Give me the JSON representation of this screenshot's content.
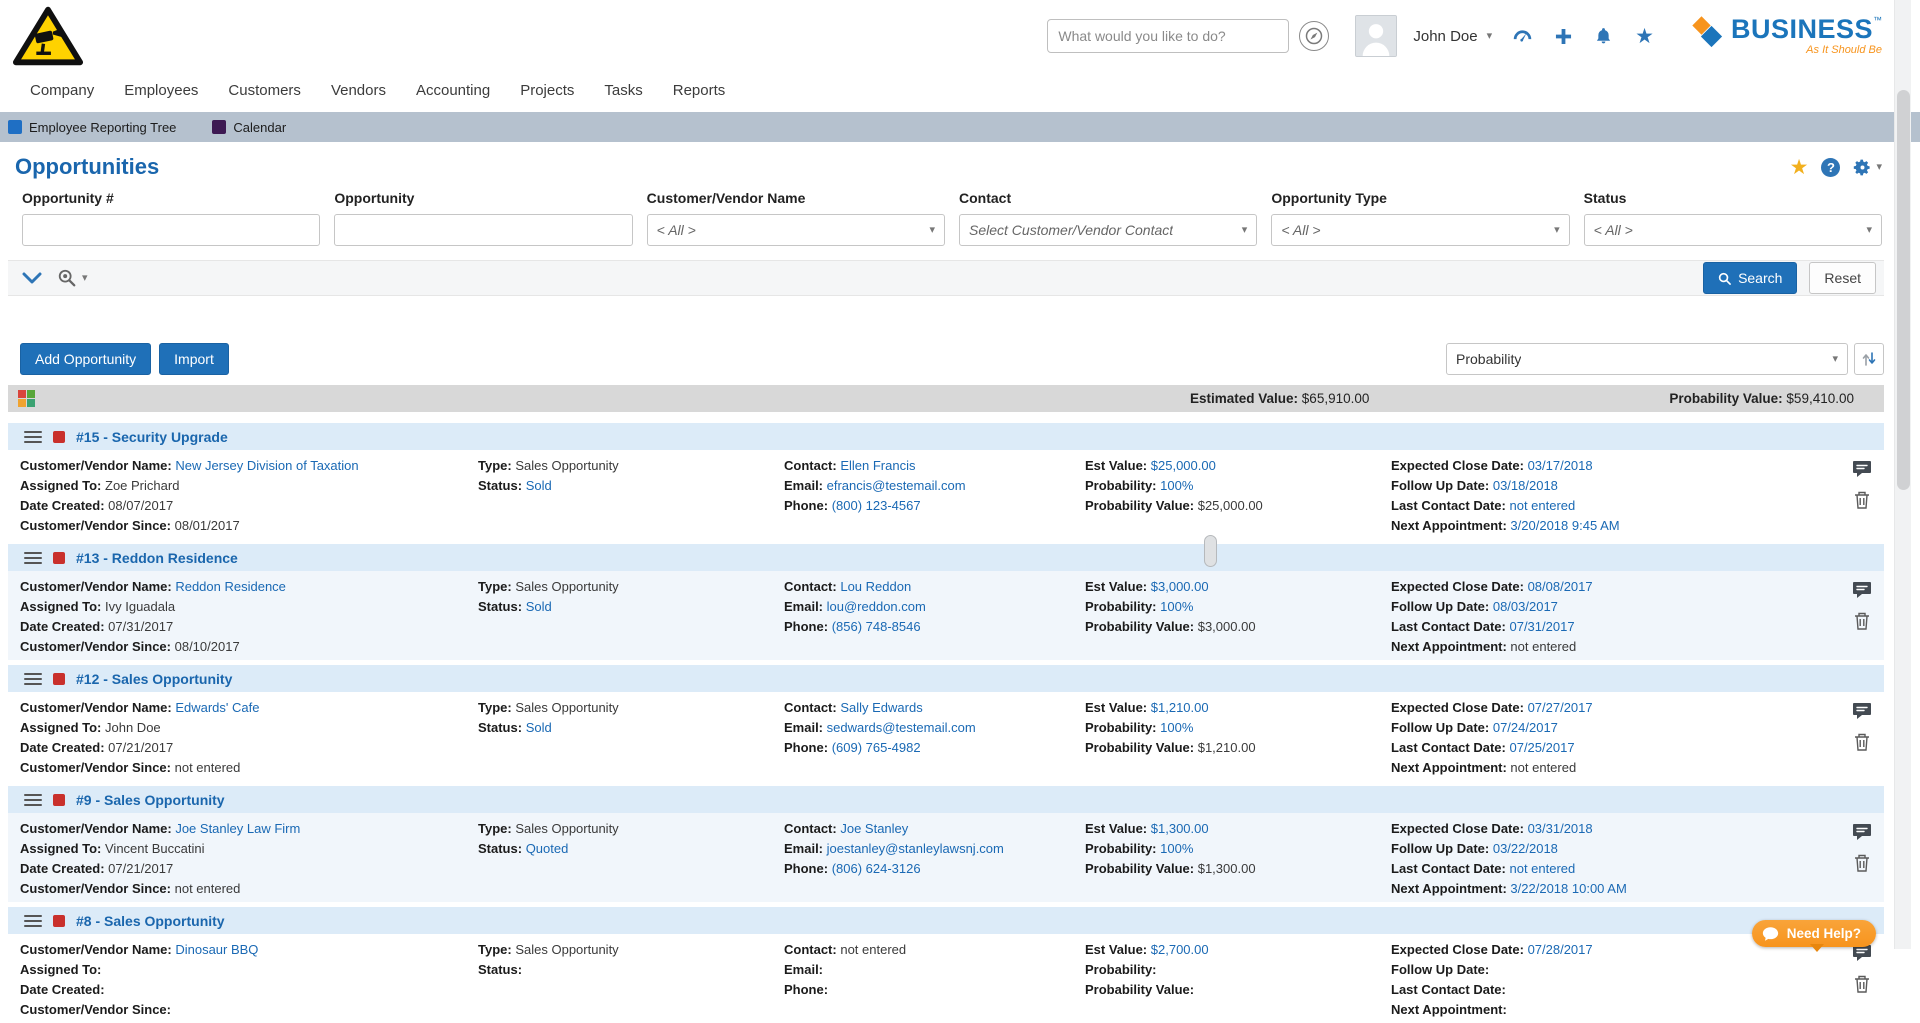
{
  "header": {
    "search_placeholder": "What would you like to do?",
    "user_name": "John Doe",
    "brand_name": "BUSINESS",
    "brand_tm": "™",
    "brand_tagline": "As It Should Be"
  },
  "nav": {
    "items": [
      "Company",
      "Employees",
      "Customers",
      "Vendors",
      "Accounting",
      "Projects",
      "Tasks",
      "Reports"
    ]
  },
  "quickbar": {
    "items": [
      {
        "label": "Employee Reporting Tree",
        "color": "#1f6fc4"
      },
      {
        "label": "Calendar",
        "color": "#3d1952"
      }
    ]
  },
  "page": {
    "title": "Opportunities"
  },
  "filters": {
    "fields": [
      {
        "label": "Opportunity #",
        "value": ""
      },
      {
        "label": "Opportunity",
        "value": ""
      },
      {
        "label": "Customer/Vendor Name",
        "value": "< All >"
      },
      {
        "label": "Contact",
        "value": "Select Customer/Vendor Contact"
      },
      {
        "label": "Opportunity Type",
        "value": "< All >"
      },
      {
        "label": "Status",
        "value": "< All >"
      }
    ],
    "search_label": "Search",
    "reset_label": "Reset"
  },
  "actions": {
    "add_label": "Add Opportunity",
    "import_label": "Import",
    "sort_value": "Probability"
  },
  "summary": {
    "estimated_label": "Estimated Value:",
    "estimated_value": "$65,910.00",
    "probability_label": "Probability Value:",
    "probability_value": "$59,410.00"
  },
  "row_labels": {
    "customer_vendor_name": "Customer/Vendor Name:",
    "assigned_to": "Assigned To:",
    "date_created": "Date Created:",
    "customer_vendor_since": "Customer/Vendor Since:",
    "type": "Type:",
    "status": "Status:",
    "contact": "Contact:",
    "email": "Email:",
    "phone": "Phone:",
    "est_value": "Est Value:",
    "probability": "Probability:",
    "probability_value": "Probability Value:",
    "expected_close_date": "Expected Close Date:",
    "follow_up_date": "Follow Up Date:",
    "last_contact_date": "Last Contact Date:",
    "next_appointment": "Next Appointment:"
  },
  "rows": [
    {
      "title": "#15 - Security Upgrade",
      "customer_vendor_name": "New Jersey Division of Taxation",
      "assigned_to": "Zoe Prichard",
      "date_created": "08/07/2017",
      "customer_vendor_since": "08/01/2017",
      "type": "Sales Opportunity",
      "status": "Sold",
      "contact": "Ellen Francis",
      "contact_cls": "link",
      "email": "efrancis@testemail.com",
      "phone": "(800) 123-4567",
      "est_value": "$25,000.00",
      "probability": "100%",
      "probability_value": "$25,000.00",
      "expected_close_date": "03/17/2018",
      "follow_up_date": "03/18/2018",
      "last_contact_date": "not entered",
      "next_appointment": "3/20/2018 9:45 AM",
      "next_appointment_cls": "link"
    },
    {
      "title": "#13 - Reddon Residence",
      "customer_vendor_name": "Reddon Residence",
      "assigned_to": "Ivy Iguadala",
      "date_created": "07/31/2017",
      "customer_vendor_since": "08/10/2017",
      "type": "Sales Opportunity",
      "status": "Sold",
      "contact": "Lou Reddon",
      "contact_cls": "link",
      "email": "lou@reddon.com",
      "phone": "(856) 748-8546",
      "est_value": "$3,000.00",
      "probability": "100%",
      "probability_value": "$3,000.00",
      "expected_close_date": "08/08/2017",
      "follow_up_date": "08/03/2017",
      "last_contact_date": "07/31/2017",
      "next_appointment": "not entered",
      "next_appointment_cls": "plain"
    },
    {
      "title": "#12 - Sales Opportunity",
      "customer_vendor_name": "Edwards' Cafe",
      "assigned_to": "John Doe",
      "date_created": "07/21/2017",
      "customer_vendor_since": "not entered",
      "type": "Sales Opportunity",
      "status": "Sold",
      "contact": "Sally Edwards",
      "contact_cls": "link",
      "email": "sedwards@testemail.com",
      "phone": "(609) 765-4982",
      "est_value": "$1,210.00",
      "probability": "100%",
      "probability_value": "$1,210.00",
      "expected_close_date": "07/27/2017",
      "follow_up_date": "07/24/2017",
      "last_contact_date": "07/25/2017",
      "next_appointment": "not entered",
      "next_appointment_cls": "plain"
    },
    {
      "title": "#9 - Sales Opportunity",
      "customer_vendor_name": "Joe Stanley Law Firm",
      "assigned_to": "Vincent Buccatini",
      "date_created": "07/21/2017",
      "customer_vendor_since": "not entered",
      "type": "Sales Opportunity",
      "status": "Quoted",
      "contact": "Joe Stanley",
      "contact_cls": "link",
      "email": "joestanley@stanleylawsnj.com",
      "phone": "(806) 624-3126",
      "est_value": "$1,300.00",
      "probability": "100%",
      "probability_value": "$1,300.00",
      "expected_close_date": "03/31/2018",
      "follow_up_date": "03/22/2018",
      "last_contact_date": "not entered",
      "next_appointment": "3/22/2018 10:00 AM",
      "next_appointment_cls": "link"
    },
    {
      "title": "#8 - Sales Opportunity",
      "customer_vendor_name": "Dinosaur BBQ",
      "assigned_to": "",
      "date_created": "",
      "customer_vendor_since": "",
      "type": "Sales Opportunity",
      "status": "",
      "contact": "not entered",
      "contact_cls": "plain",
      "email": "",
      "phone": "",
      "est_value": "$2,700.00",
      "probability": "",
      "probability_value": "",
      "expected_close_date": "07/28/2017",
      "follow_up_date": "",
      "last_contact_date": "",
      "next_appointment": "",
      "next_appointment_cls": "plain"
    }
  ],
  "help": {
    "label": "Need Help?"
  },
  "colors": {
    "accent_blue": "#1f70b8",
    "link_blue": "#1a69b4",
    "row_header_blue": "#dcebf8",
    "brand_orange": "#f7941d",
    "flag_red": "#c9302c",
    "quickbar_gray_blue": "#b5c1ce"
  }
}
